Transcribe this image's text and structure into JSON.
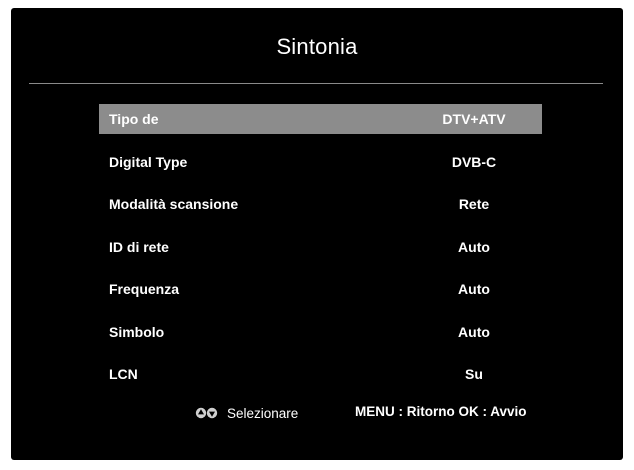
{
  "title": "Sintonia",
  "menu": {
    "items": [
      {
        "label": "Tipo de",
        "value": "DTV+ATV",
        "selected": true
      },
      {
        "label": "Digital Type",
        "value": "DVB-C",
        "selected": false
      },
      {
        "label": "Modalità scansione",
        "value": "Rete",
        "selected": false
      },
      {
        "label": "ID di rete",
        "value": "Auto",
        "selected": false
      },
      {
        "label": "Frequenza",
        "value": "Auto",
        "selected": false
      },
      {
        "label": "Simbolo",
        "value": "Auto",
        "selected": false
      },
      {
        "label": "LCN",
        "value": "Su",
        "selected": false
      }
    ]
  },
  "footer": {
    "select_icon": "up-down-arrows-icon",
    "select_label": "Selezionare",
    "hint": "MENU : Ritorno OK : Avvio"
  },
  "colors": {
    "background": "#000000",
    "selected_row": "#8c8c8c",
    "text": "#ffffff"
  }
}
